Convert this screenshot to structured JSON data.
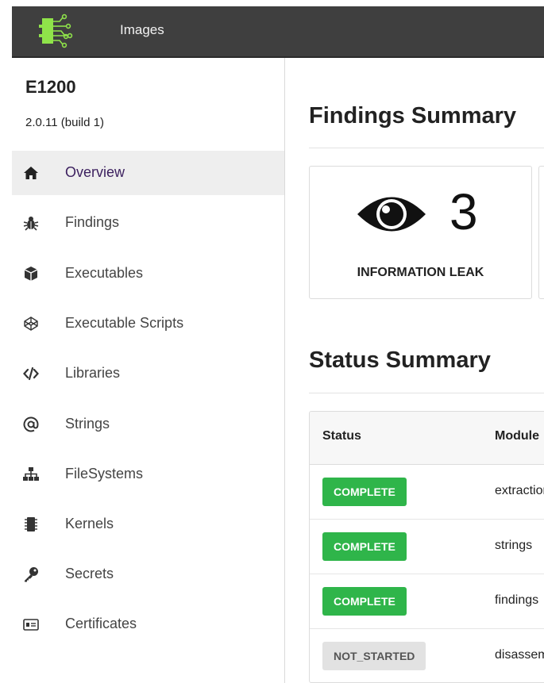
{
  "navbar": {
    "title": "Images"
  },
  "project": {
    "name": "E1200",
    "version": "2.0.11 (build 1)"
  },
  "sidebar": {
    "items": [
      {
        "label": "Overview",
        "icon": "home-icon",
        "active": true
      },
      {
        "label": "Findings",
        "icon": "bug-icon"
      },
      {
        "label": "Executables",
        "icon": "cube-icon"
      },
      {
        "label": "Executable Scripts",
        "icon": "codepen-icon"
      },
      {
        "label": "Libraries",
        "icon": "code-icon"
      },
      {
        "label": "Strings",
        "icon": "at-icon"
      },
      {
        "label": "FileSystems",
        "icon": "sitemap-icon"
      },
      {
        "label": "Kernels",
        "icon": "microchip-icon"
      },
      {
        "label": "Secrets",
        "icon": "key-icon"
      },
      {
        "label": "Certificates",
        "icon": "id-card-icon"
      }
    ]
  },
  "findings_summary": {
    "heading": "Findings Summary",
    "cards": [
      {
        "count": "3",
        "label": "INFORMATION LEAK",
        "icon": "eye-icon"
      }
    ]
  },
  "status_summary": {
    "heading": "Status Summary",
    "columns": [
      "Status",
      "Module"
    ],
    "rows": [
      {
        "status": "COMPLETE",
        "module": "extraction"
      },
      {
        "status": "COMPLETE",
        "module": "strings"
      },
      {
        "status": "COMPLETE",
        "module": "findings"
      },
      {
        "status": "NOT_STARTED",
        "module": "disassembly"
      }
    ]
  },
  "colors": {
    "navbar_bg": "#3f3f3f",
    "logo": "#8fe34a",
    "complete": "#2fb54a",
    "not_started": "#e2e2e2",
    "active_item_bg": "#eeeeee"
  }
}
